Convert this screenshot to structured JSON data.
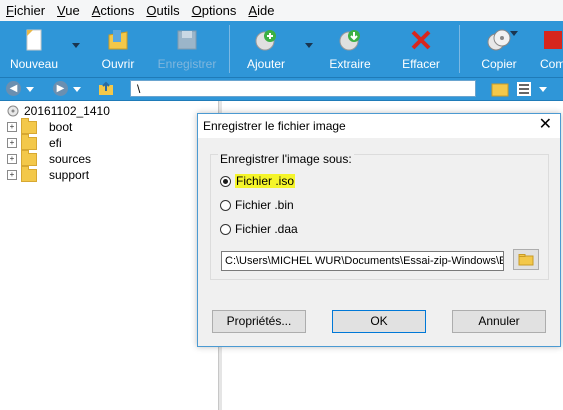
{
  "menu": {
    "items": [
      {
        "first": "F",
        "rest": "ichier"
      },
      {
        "first": "V",
        "rest": "ue"
      },
      {
        "first": "A",
        "rest": "ctions"
      },
      {
        "first": "O",
        "rest": "utils"
      },
      {
        "first": "O",
        "rest": "ptions"
      },
      {
        "first": "A",
        "rest": "ide"
      }
    ]
  },
  "toolbar": {
    "nouveau": "Nouveau",
    "ouvrir": "Ouvrir",
    "enregistrer": "Enregistrer",
    "ajouter": "Ajouter",
    "extraire": "Extraire",
    "effacer": "Effacer",
    "copier": "Copier",
    "comp": "Comp"
  },
  "navbar": {
    "path": "\\"
  },
  "tree": {
    "root": "20161102_1410",
    "folders": [
      "boot",
      "efi",
      "sources",
      "support"
    ]
  },
  "dialog": {
    "title": "Enregistrer le fichier image",
    "group_label": "Enregistrer l'image sous:",
    "options": [
      "Fichier .iso",
      "Fichier .bin",
      "Fichier .daa"
    ],
    "selected_index": 0,
    "path_value": "C:\\Users\\MICHEL WUR\\Documents\\Essai-zip-Windows\\Essa",
    "buttons": {
      "properties": "Propriétés...",
      "ok": "OK",
      "cancel": "Annuler"
    }
  },
  "colors": {
    "toolbar": "#2f96d8",
    "highlight": "#f5f52a",
    "accent": "#0078d7"
  }
}
